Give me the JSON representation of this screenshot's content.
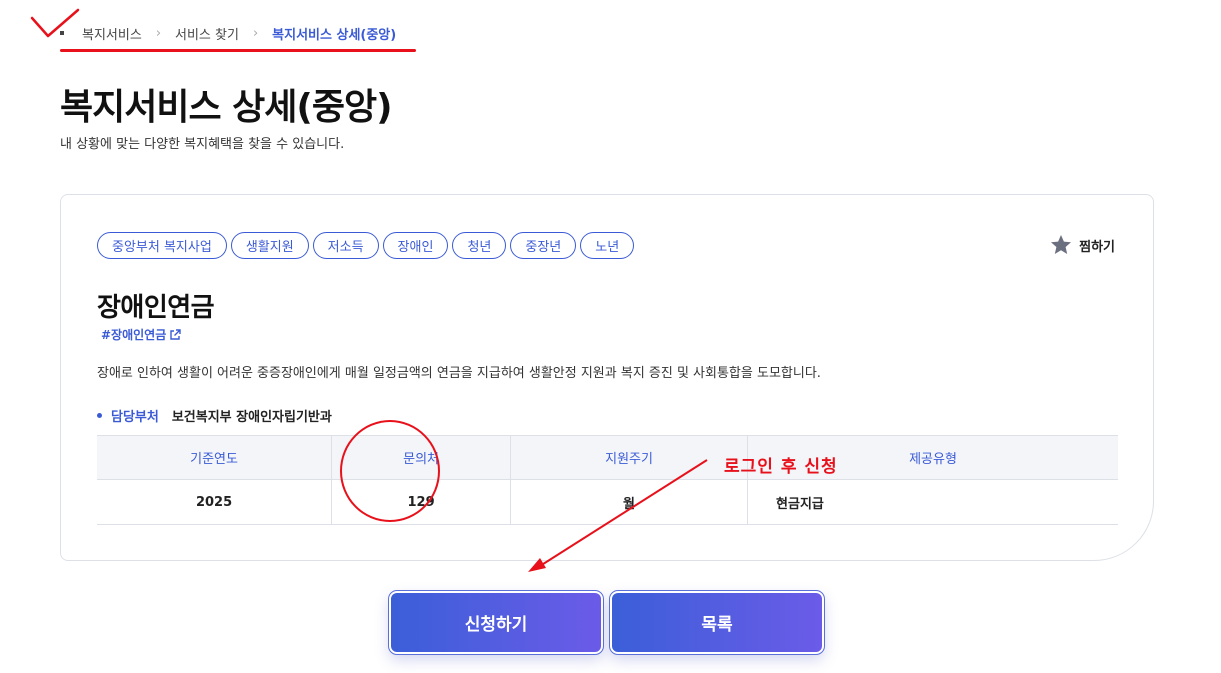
{
  "breadcrumb": {
    "items": [
      "복지서비스",
      "서비스 찾기"
    ],
    "current": "복지서비스 상세(중앙)"
  },
  "page": {
    "title": "복지서비스 상세(중앙)",
    "subtitle": "내 상황에 맞는 다양한 복지혜택을 찾을 수 있습니다."
  },
  "service": {
    "tags": [
      "중앙부처 복지사업",
      "생활지원",
      "저소득",
      "장애인",
      "청년",
      "중장년",
      "노년"
    ],
    "bookmark_label": "찜하기",
    "name": "장애인연금",
    "hashtag": "#장애인연금",
    "description": "장애로 인하여 생활이 어려운 중증장애인에게 매월 일정금액의 연금을 지급하여 생활안정 지원과 복지 증진 및 사회통합을 도모합니다.",
    "department_label": "담당부처",
    "department_value": "보건복지부 장애인자립기반과",
    "table": {
      "headers": [
        "기준연도",
        "문의처",
        "지원주기",
        "제공유형"
      ],
      "row": [
        "2025",
        "129",
        "월",
        "현금지급"
      ]
    }
  },
  "annotation": {
    "text": "로그인 후 신청"
  },
  "actions": {
    "apply_label": "신청하기",
    "list_label": "목록"
  },
  "colors": {
    "accent": "#3b5bd6",
    "annotation": "#e8111b"
  }
}
